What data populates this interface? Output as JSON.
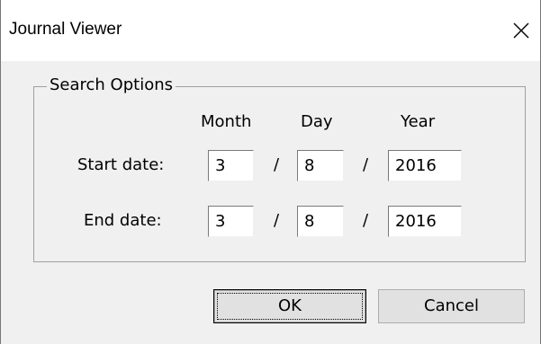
{
  "window": {
    "title": "Journal Viewer",
    "close_icon": "close-icon"
  },
  "search_options": {
    "group_label": "Search Options",
    "col_month": "Month",
    "col_day": "Day",
    "col_year": "Year",
    "separator": "/",
    "start": {
      "label": "Start date:",
      "month": "3",
      "day": "8",
      "year": "2016"
    },
    "end": {
      "label": "End date:",
      "month": "3",
      "day": "8",
      "year": "2016"
    }
  },
  "buttons": {
    "ok": "OK",
    "cancel": "Cancel"
  }
}
